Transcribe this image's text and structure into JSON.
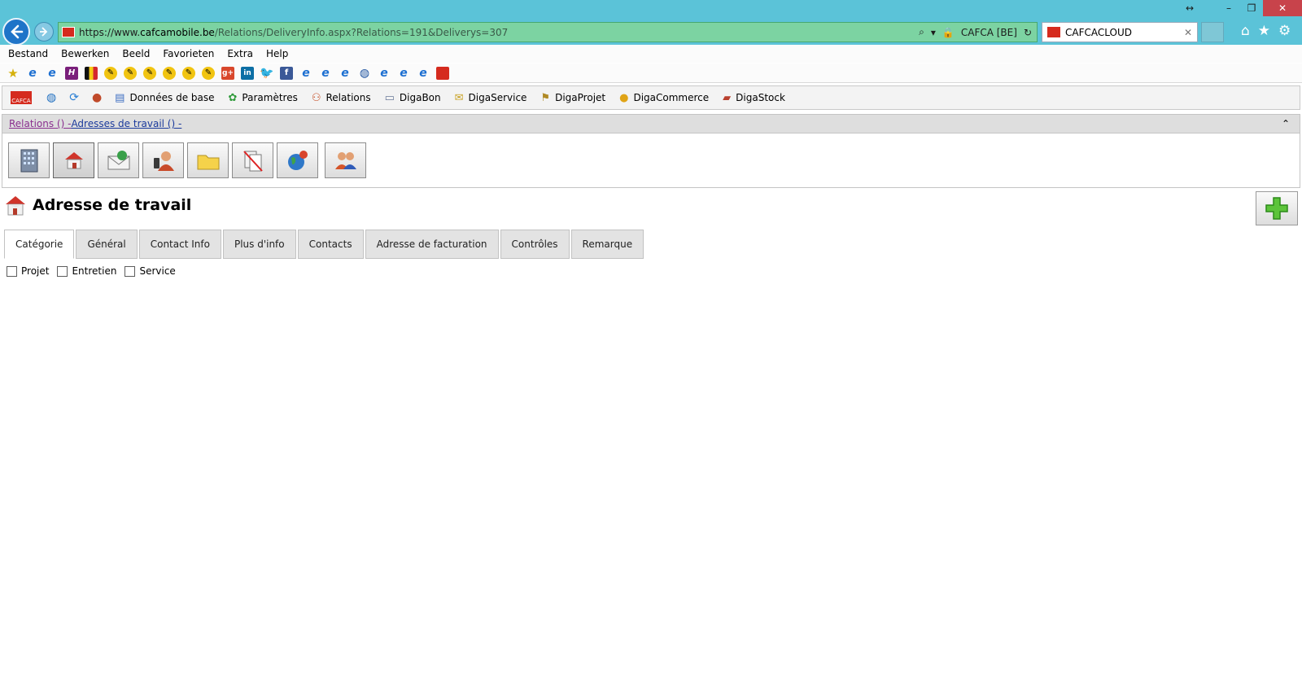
{
  "browser": {
    "url_prefix": "https://www.",
    "url_host": "cafcamobile.be",
    "url_path": "/Relations/DeliveryInfo.aspx?Relations=191&Deliverys=307",
    "cert_label": "CAFCA [BE]",
    "tab_title": "CAFCACLOUD",
    "colors": {
      "frame": "#5bc3d8",
      "address_bar": "#7cd3a2",
      "close": "#c8434b"
    }
  },
  "menu": {
    "items": [
      "Bestand",
      "Bewerken",
      "Beeld",
      "Favorieten",
      "Extra",
      "Help"
    ]
  },
  "favorites": {
    "icons": [
      "star-add-icon",
      "ie-page-icon",
      "ie-page-icon",
      "h-logo-icon",
      "belgium-flag-icon",
      "wasp-icon",
      "wasp-icon",
      "wasp-icon",
      "wasp-icon",
      "wasp-icon",
      "wasp-icon",
      "google-plus-icon",
      "linkedin-icon",
      "twitter-icon",
      "facebook-icon",
      "ie-page-icon",
      "ie-page-icon",
      "ie-page-icon",
      "globe-icon",
      "ie-page-icon",
      "ie-page-icon",
      "ie-page-icon",
      "cafca-logo-icon"
    ],
    "labels": {
      "gplus": "g+",
      "linkedin": "in",
      "facebook": "f",
      "h": "H"
    }
  },
  "app_toolbar": {
    "logo_text": "CAFCA",
    "items": [
      "Données de base",
      "Paramètres",
      "Relations",
      "DigaBon",
      "DigaService",
      "DigaProjet",
      "DigaCommerce",
      "DigaStock"
    ]
  },
  "breadcrumb": {
    "part1": "Relations () - ",
    "part2": "Adresses de travail () -"
  },
  "icon_panel": {
    "buttons": [
      "building-icon",
      "house-icon",
      "envelope-icon",
      "contact-phone-icon",
      "folder-icon",
      "document-no-icon",
      "globe-user-icon",
      "group-icon"
    ],
    "active_index": 1
  },
  "page": {
    "title": "Adresse de travail",
    "tabs": [
      "Catégorie",
      "Général",
      "Contact Info",
      "Plus d'info",
      "Contacts",
      "Adresse de facturation",
      "Contrôles",
      "Remarque"
    ],
    "active_tab": 0,
    "checkboxes": [
      {
        "label": "Projet",
        "checked": false
      },
      {
        "label": "Entretien",
        "checked": false
      },
      {
        "label": "Service",
        "checked": false
      }
    ]
  }
}
